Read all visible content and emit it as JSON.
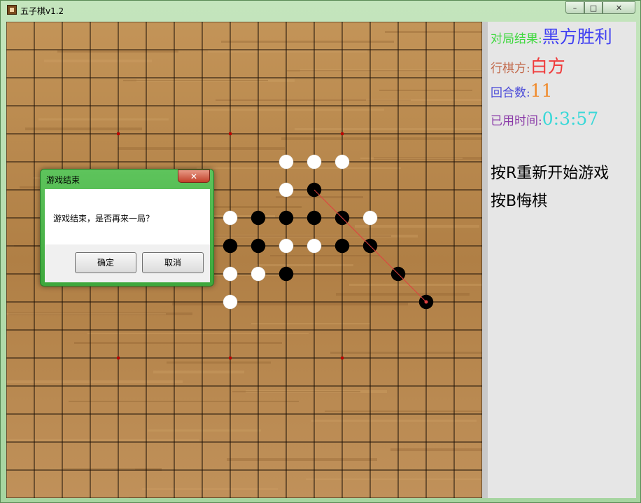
{
  "window": {
    "title": "五子棋v1.2",
    "minimize_glyph": "–",
    "maximize_glyph": "□",
    "close_glyph": "✕"
  },
  "board": {
    "grid_lines": 17,
    "star_points": [
      [
        4,
        4
      ],
      [
        8,
        4
      ],
      [
        12,
        4
      ],
      [
        4,
        12
      ],
      [
        8,
        12
      ],
      [
        12,
        12
      ]
    ],
    "stones": [
      {
        "col": 10,
        "row": 5,
        "color": "white"
      },
      {
        "col": 11,
        "row": 5,
        "color": "white"
      },
      {
        "col": 12,
        "row": 5,
        "color": "white"
      },
      {
        "col": 10,
        "row": 6,
        "color": "white"
      },
      {
        "col": 11,
        "row": 6,
        "color": "black"
      },
      {
        "col": 8,
        "row": 7,
        "color": "white"
      },
      {
        "col": 9,
        "row": 7,
        "color": "black"
      },
      {
        "col": 10,
        "row": 7,
        "color": "black"
      },
      {
        "col": 11,
        "row": 7,
        "color": "black"
      },
      {
        "col": 12,
        "row": 7,
        "color": "black"
      },
      {
        "col": 13,
        "row": 7,
        "color": "white"
      },
      {
        "col": 8,
        "row": 8,
        "color": "black"
      },
      {
        "col": 9,
        "row": 8,
        "color": "black"
      },
      {
        "col": 10,
        "row": 8,
        "color": "white"
      },
      {
        "col": 11,
        "row": 8,
        "color": "white"
      },
      {
        "col": 12,
        "row": 8,
        "color": "black"
      },
      {
        "col": 13,
        "row": 8,
        "color": "black"
      },
      {
        "col": 8,
        "row": 9,
        "color": "white"
      },
      {
        "col": 9,
        "row": 9,
        "color": "white"
      },
      {
        "col": 10,
        "row": 9,
        "color": "black"
      },
      {
        "col": 14,
        "row": 9,
        "color": "black"
      },
      {
        "col": 8,
        "row": 10,
        "color": "white"
      },
      {
        "col": 15,
        "row": 10,
        "color": "black"
      }
    ],
    "win_line": {
      "from": [
        11,
        6
      ],
      "to": [
        15,
        10
      ]
    },
    "last_move": [
      15,
      10
    ]
  },
  "panel": {
    "result_label": "对局结果:",
    "result_value": "黑方胜利",
    "turn_label": "行棋方:",
    "turn_value": "白方",
    "rounds_label": "回合数:",
    "rounds_value": "11",
    "time_label": "已用时间:",
    "time_value": "0:3:57",
    "hint_restart": "按R重新开始游戏",
    "hint_undo": "按B悔棋"
  },
  "colors": {
    "result_label": "#3fd83f",
    "result_value": "#3f3ff2",
    "turn_label": "#c26a4c",
    "turn_value": "#f03a3a",
    "rounds_label": "#4d4dd8",
    "rounds_value": "#f08a2a",
    "time_label": "#8a3aa8",
    "time_value": "#3ad8d8",
    "grid": "#1a0f06",
    "star": "#c00000",
    "win_line": "#e04040"
  },
  "dialog": {
    "title": "游戏结束",
    "close_glyph": "✕",
    "message": "游戏结束，是否再来一局？",
    "ok_label": "确定",
    "cancel_label": "取消"
  }
}
